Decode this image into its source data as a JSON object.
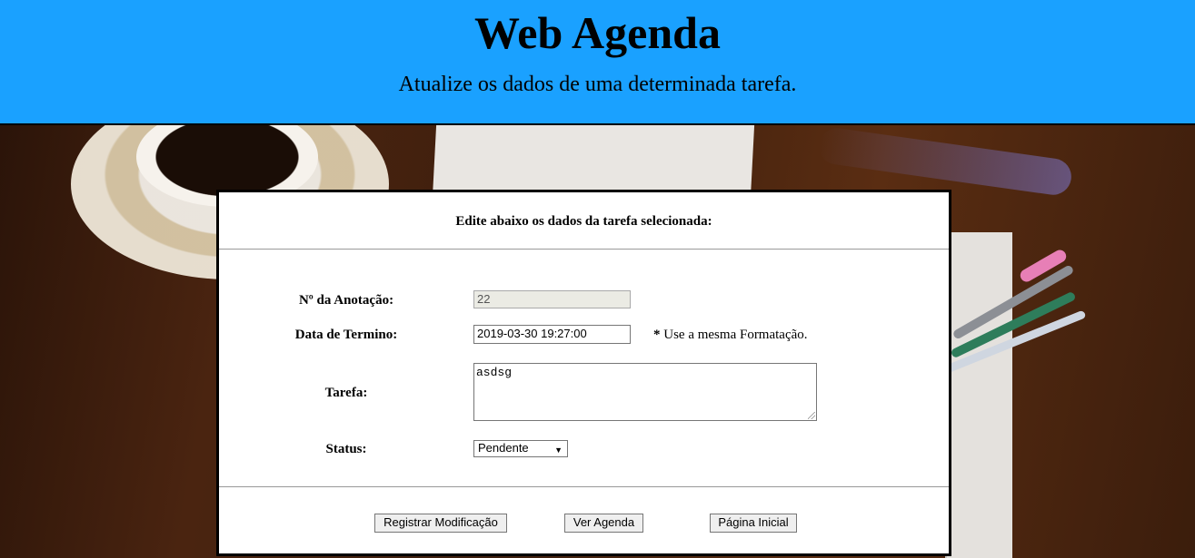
{
  "header": {
    "title": "Web Agenda",
    "subtitle": "Atualize os dados de uma determinada tarefa."
  },
  "form": {
    "heading": "Edite abaixo os dados da tarefa selecionada:",
    "fields": {
      "note_number": {
        "label": "Nº da Anotação:",
        "value": "22"
      },
      "end_date": {
        "label": "Data de Termino:",
        "value": "2019-03-30 19:27:00",
        "hint_star": "*",
        "hint": "Use a mesma Formatação."
      },
      "task": {
        "label": "Tarefa:",
        "value": "asdsg"
      },
      "status": {
        "label": "Status:",
        "value": "Pendente",
        "arrow": "▼"
      }
    },
    "buttons": {
      "save": "Registrar Modificação",
      "view": "Ver Agenda",
      "home": "Página Inicial"
    }
  },
  "colors": {
    "header_bg": "#1aa1ff",
    "panel_bg": "#ffffff"
  }
}
